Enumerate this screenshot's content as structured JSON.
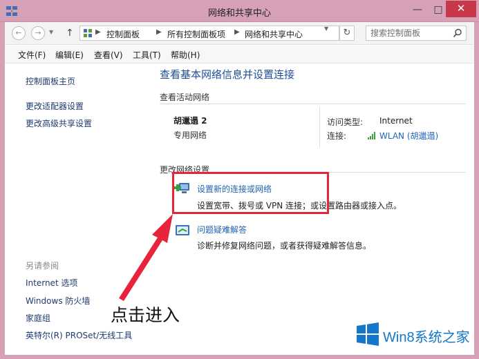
{
  "window": {
    "title": "网络和共享中心",
    "controls": {
      "minimize": "—",
      "maximize": "□",
      "close": "✕"
    }
  },
  "address_bar": {
    "breadcrumbs": [
      "控制面板",
      "所有控制面板项",
      "网络和共享中心"
    ],
    "search_placeholder": "搜索控制面板"
  },
  "menu": [
    "文件(F)",
    "编辑(E)",
    "查看(V)",
    "工具(T)",
    "帮助(H)"
  ],
  "sidebar": {
    "links": [
      "控制面板主页",
      "更改适配器设置",
      "更改高级共享设置"
    ],
    "see_also_label": "另请参阅",
    "see_also": [
      "Internet 选项",
      "Windows 防火墙",
      "家庭组",
      "英特尔(R) PROSet/无线工具"
    ]
  },
  "main": {
    "title": "查看基本网络信息并设置连接",
    "active_networks_label": "查看活动网络",
    "network": {
      "name": "胡邋遢  2",
      "type": "专用网络",
      "access_type_label": "访问类型:",
      "access_type_value": "Internet",
      "connection_label": "连接:",
      "connection_value": "WLAN (胡邋遢)"
    },
    "change_settings_label": "更改网络设置",
    "tasks": [
      {
        "title": "设置新的连接或网络",
        "desc": "设置宽带、拨号或 VPN 连接；或设置路由器或接入点。",
        "icon": "new-connection-icon"
      },
      {
        "title": "问题疑难解答",
        "desc": "诊断并修复网络问题，或者获得疑难解答信息。",
        "icon": "troubleshoot-icon"
      }
    ]
  },
  "annotation": {
    "text": "点击进入",
    "color": "#e8243c"
  },
  "watermark": {
    "text": "Win8系统之家"
  },
  "colors": {
    "titlebar": "#d6a1b6",
    "link": "#1f63b6",
    "title": "#1f4e99",
    "close": "#c7384a"
  }
}
